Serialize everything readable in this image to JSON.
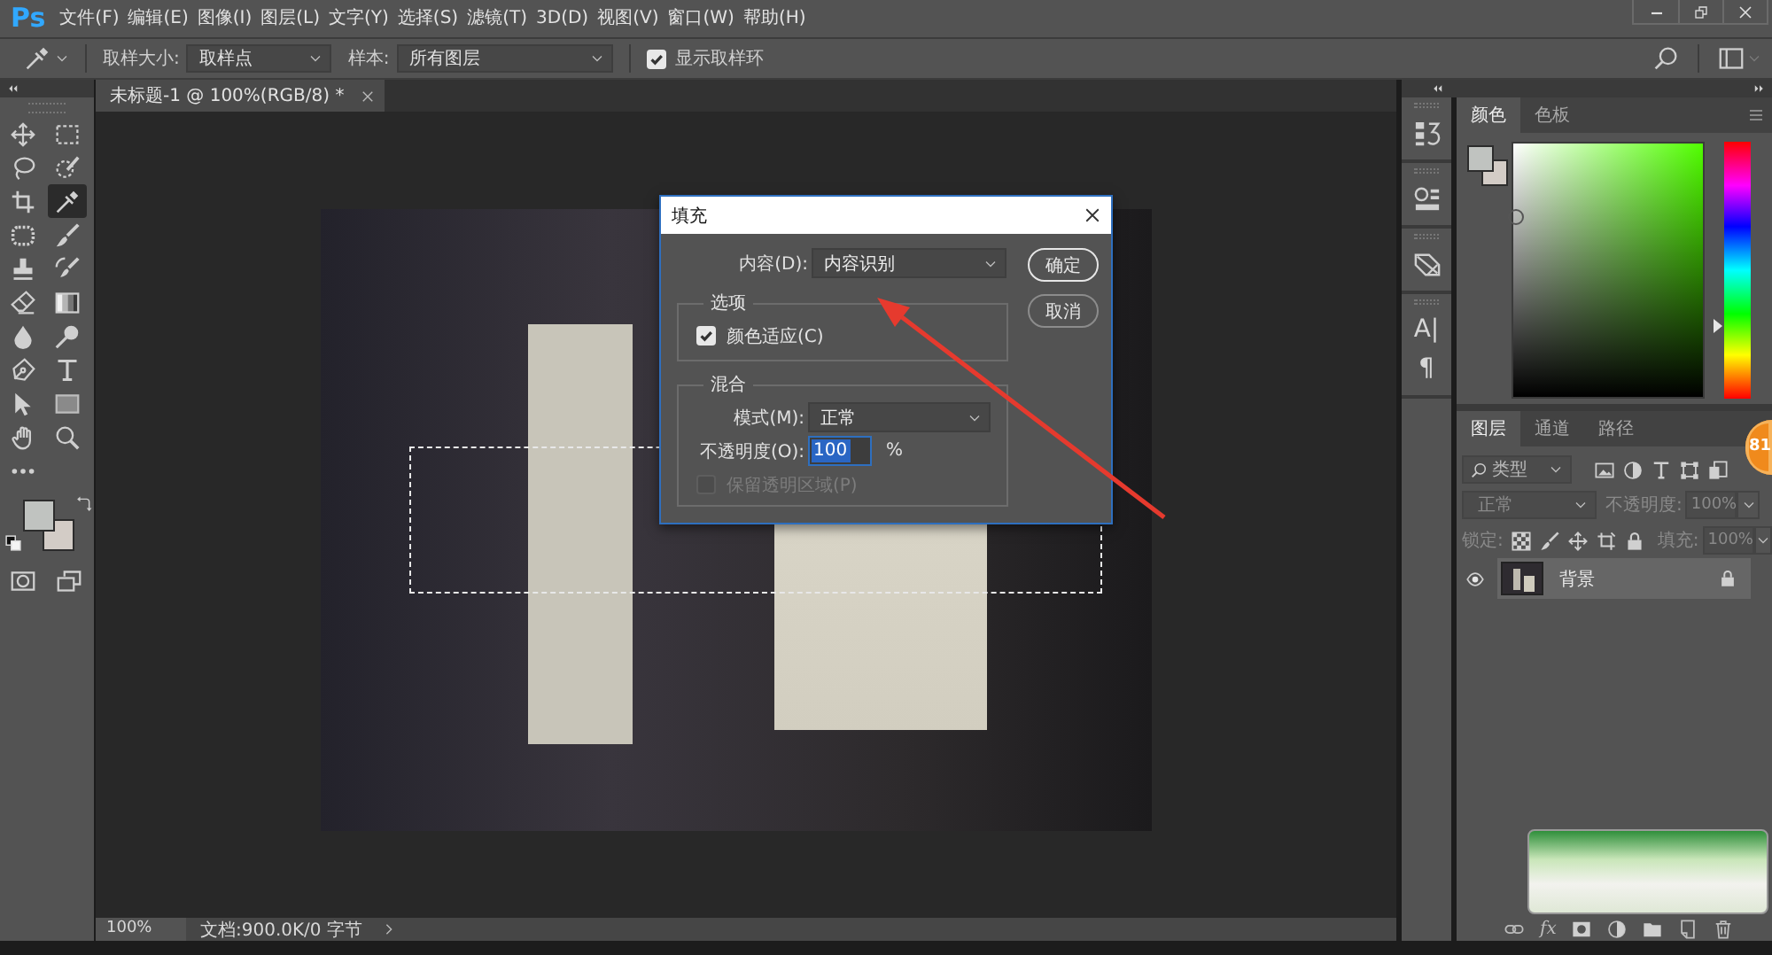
{
  "menu_bar": {
    "logo": "Ps",
    "items": [
      "文件(F)",
      "编辑(E)",
      "图像(I)",
      "图层(L)",
      "文字(Y)",
      "选择(S)",
      "滤镜(T)",
      "3D(D)",
      "视图(V)",
      "窗口(W)",
      "帮助(H)"
    ]
  },
  "options_bar": {
    "sample_size": {
      "label": "取样大小:",
      "value": "取样点"
    },
    "sample": {
      "label": "样本:",
      "value": "所有图层"
    },
    "show_ring": {
      "label": "显示取样环",
      "checked": true
    }
  },
  "toolbar": {
    "tools": [
      {
        "kind": "move",
        "selected": false
      },
      {
        "kind": "marquee",
        "selected": false
      },
      {
        "kind": "lasso",
        "selected": false
      },
      {
        "kind": "quick-select",
        "selected": false
      },
      {
        "kind": "crop",
        "selected": false
      },
      {
        "kind": "eyedropper",
        "selected": true
      },
      {
        "kind": "patch",
        "selected": false
      },
      {
        "kind": "brush",
        "selected": false
      },
      {
        "kind": "stamp",
        "selected": false
      },
      {
        "kind": "history-brush",
        "selected": false
      },
      {
        "kind": "eraser",
        "selected": false
      },
      {
        "kind": "gradient",
        "selected": false
      },
      {
        "kind": "blur",
        "selected": false
      },
      {
        "kind": "dodge",
        "selected": false
      },
      {
        "kind": "pen",
        "selected": false
      },
      {
        "kind": "type",
        "selected": false
      },
      {
        "kind": "path-select",
        "selected": false
      },
      {
        "kind": "shape",
        "selected": false
      },
      {
        "kind": "hand",
        "selected": false
      },
      {
        "kind": "zoom",
        "selected": false
      },
      {
        "kind": "more",
        "selected": false
      }
    ],
    "swatches": [
      {
        "kind": "background",
        "color": "#d3ccc6"
      },
      {
        "kind": "foreground",
        "color": "#c0c3c0"
      }
    ]
  },
  "document": {
    "tab": {
      "title": "未标题-1 @ 100%(RGB/8) *"
    },
    "status_bar": {
      "zoom": "100%",
      "info": "文档:900.0K/0 字节"
    }
  },
  "dialog": {
    "title": "填充",
    "content": {
      "label": "内容(D):",
      "value": "内容识别"
    },
    "buttons": [
      {
        "label": "确定",
        "default": true
      },
      {
        "label": "取消",
        "default": false
      }
    ],
    "options": {
      "title": "选项",
      "color_adapt": {
        "label": "颜色适应(C)",
        "checked": true
      }
    },
    "blending": {
      "title": "混合",
      "mode": {
        "label": "模式(M):",
        "value": "正常"
      },
      "opacity": {
        "label": "不透明度(O):",
        "value": "100",
        "unit": "%",
        "highlighted": true
      },
      "preserve": {
        "label": "保留透明区域(P)",
        "checked": false,
        "disabled": true
      }
    }
  },
  "dock": [
    {
      "items": [
        {
          "kind": "history"
        }
      ]
    },
    {
      "items": [
        {
          "kind": "properties"
        }
      ]
    },
    {
      "items": [
        {
          "kind": "transform"
        }
      ]
    },
    {
      "items": [
        {
          "kind": "character",
          "glyph": "A|"
        },
        {
          "kind": "paragraph",
          "glyph": "¶"
        }
      ]
    }
  ],
  "color_panel": {
    "tabs": [
      {
        "label": "颜色",
        "selected": true
      },
      {
        "label": "色板",
        "selected": false
      }
    ],
    "swatches": [
      {
        "kind": "background",
        "color": "#d3ccc6"
      },
      {
        "kind": "foreground",
        "color": "#c0c3c0"
      }
    ],
    "hue_slider": {
      "level": 0.28
    }
  },
  "layers_panel": {
    "tabs": [
      {
        "label": "图层",
        "selected": true
      },
      {
        "label": "通道",
        "selected": false
      },
      {
        "label": "路径",
        "selected": false
      }
    ],
    "filter": {
      "value": "类型"
    },
    "blend_mode": {
      "value": "正常",
      "disabled": true
    },
    "opacity": {
      "label": "不透明度:",
      "value": "100%",
      "disabled": true
    },
    "lock": {
      "label": "锁定:",
      "disabled": true
    },
    "fill": {
      "label": "填充:",
      "value": "100%",
      "disabled": true
    },
    "layers": [
      {
        "name": "背景",
        "visible": true,
        "locked": true,
        "selected": true
      }
    ],
    "footer": [
      {
        "kind": "link"
      },
      {
        "kind": "fx",
        "glyph": "fx"
      },
      {
        "kind": "mask"
      },
      {
        "kind": "adjustment"
      },
      {
        "kind": "folder"
      },
      {
        "kind": "new"
      },
      {
        "kind": "trash"
      }
    ]
  },
  "badge": {
    "text": "81"
  }
}
